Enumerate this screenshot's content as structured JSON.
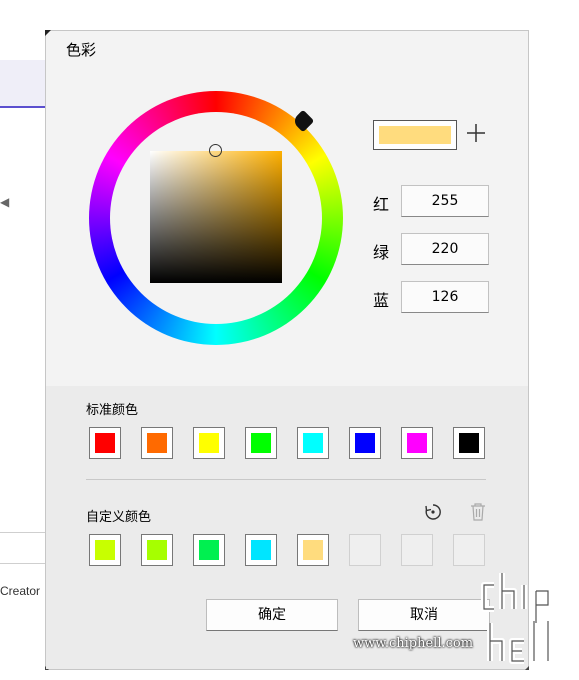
{
  "background_app": {
    "creator_text": "Creator"
  },
  "dialog": {
    "title": "色彩",
    "preview_color": "#ffdc7e",
    "add_icon": "plus-icon",
    "channels": [
      {
        "label": "红",
        "value": "255"
      },
      {
        "label": "绿",
        "value": "220"
      },
      {
        "label": "蓝",
        "value": "126"
      }
    ],
    "standard_label": "标准颜色",
    "standard_colors": [
      "#ff0000",
      "#ff6a00",
      "#ffff00",
      "#00ff00",
      "#00ffff",
      "#0000ff",
      "#ff00ff",
      "#000000"
    ],
    "custom_label": "自定义颜色",
    "custom_colors": [
      "#c8ff00",
      "#a6ff00",
      "#00f050",
      "#00e5ff",
      "#ffdc7e",
      "",
      "",
      ""
    ],
    "reset_icon": "reset-icon",
    "trash_icon": "trash-icon",
    "ok_label": "确定",
    "cancel_label": "取消"
  },
  "watermark": {
    "url": "www.chiphell.com"
  }
}
